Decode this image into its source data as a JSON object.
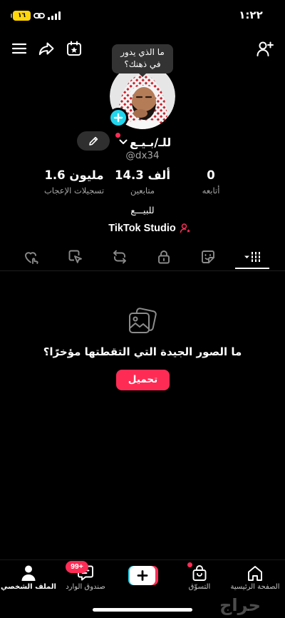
{
  "colors": {
    "background": "#000000",
    "text": "#ffffff",
    "muted": "#a6a6a6",
    "accent": "#fe2c55",
    "cyan": "#20d5ec",
    "battery": "#ffd60a",
    "tooltip": "#333333"
  },
  "status_bar": {
    "time": "١:٢٢",
    "battery_level": "١٦",
    "icons": [
      "battery-icon",
      "link-icon",
      "signal-icon"
    ]
  },
  "top_bar": {
    "left_icons": [
      "menu-icon",
      "share-icon",
      "calendar-star-icon"
    ],
    "right_icons": [
      "add-person-icon"
    ]
  },
  "tooltip": {
    "lines": [
      "ما الذي يدور",
      "في ذهنك؟"
    ]
  },
  "profile": {
    "avatar_badge_icon": "plus-icon",
    "edit_icon": "pencil-icon",
    "name": "للـ/بـيـع",
    "username": "@dx34",
    "bio": "للبيـــع",
    "studio_label": "TikTok Studio",
    "studio_icon": "person-star-icon"
  },
  "stats": [
    {
      "value": "1.6 مليون",
      "label": "تسجيلات الإعجاب"
    },
    {
      "value": "14.3 ألف",
      "label": "متابعين"
    },
    {
      "value": "0",
      "label": "أتابعه"
    }
  ],
  "tabs": [
    {
      "icon": "heart-hand-icon",
      "selected": false
    },
    {
      "icon": "tap-square-icon",
      "selected": false
    },
    {
      "icon": "repost-icon",
      "selected": false
    },
    {
      "icon": "lock-icon",
      "selected": false
    },
    {
      "icon": "sticker-icon",
      "selected": false
    },
    {
      "icon": "grid-dropdown-icon",
      "selected": true
    }
  ],
  "empty_state": {
    "icon": "photos-icon",
    "message": "ما الصور الجيدة التي التقطتها مؤخرًا؟",
    "button_label": "تحميل"
  },
  "bottom_nav": [
    {
      "label": "الملف الشخصي",
      "icon": "profile-icon",
      "selected": true
    },
    {
      "label": "صندوق الوارد",
      "icon": "inbox-icon",
      "badge": "99+"
    },
    {
      "icon": "create-plus-icon"
    },
    {
      "label": "التسوّق",
      "icon": "shop-bag-icon",
      "dot": true
    },
    {
      "label": "الصفحة الرئيسية",
      "icon": "home-icon"
    }
  ],
  "watermark": "حراج"
}
